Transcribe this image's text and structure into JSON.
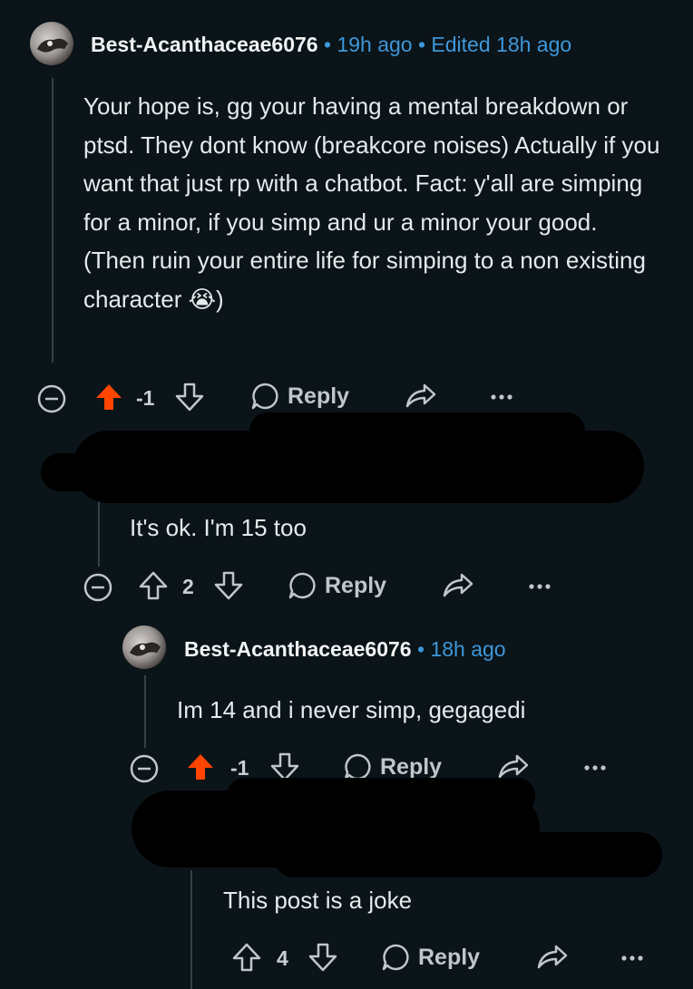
{
  "comments": [
    {
      "username": "Best-Acanthaceae6076",
      "time": "19h ago",
      "edited": "Edited 18h ago",
      "body": "Your hope is, gg your having a mental breakdown or ptsd. They dont know (breakcore noises) Actually if you want that just rp with a chatbot. Fact: y'all are simping for a minor, if you simp and ur a minor your good. (Then ruin your entire life for simping to a non existing character 😭)",
      "score": "-1",
      "vote_state": "upvoted",
      "reply_label": "Reply"
    },
    {
      "username": "",
      "time": "",
      "body": "It's ok. I'm 15 too",
      "score": "2",
      "vote_state": "none",
      "reply_label": "Reply"
    },
    {
      "username": "Best-Acanthaceae6076",
      "time": "18h ago",
      "body": "Im 14 and i never simp, gegagedi",
      "score": "-1",
      "vote_state": "upvoted",
      "reply_label": "Reply"
    },
    {
      "username": "",
      "time": "",
      "body": "This post is a joke",
      "score": "4",
      "vote_state": "none",
      "reply_label": "Reply"
    }
  ],
  "separator": "•",
  "colors": {
    "background": "#0a1419",
    "link_blue": "#3f97d9",
    "upvote_orange": "#ff4500",
    "icon_gray": "#bfc7cc",
    "thread_line": "#33424a"
  },
  "icons": [
    "collapse-icon",
    "upvote-icon",
    "downvote-icon",
    "reply-bubble-icon",
    "share-icon",
    "more-options-icon"
  ]
}
